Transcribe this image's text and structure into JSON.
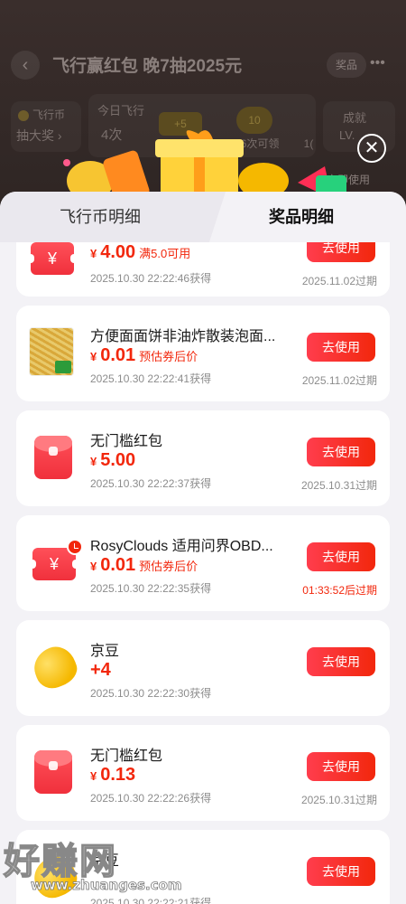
{
  "background": {
    "back_glyph": "‹",
    "title": "飞行赢红包 晚7抽2025元",
    "prize_btn": "奖品",
    "more_glyph": "•••",
    "coin_box_line1": "飞行币",
    "coin_box_line2": "抽大奖 ›",
    "today_label": "今日飞行",
    "today_count": "4次",
    "pill_a": "+5",
    "pill_b": "10",
    "pill_c": "6次可领",
    "pill_d": "1(",
    "achievement_line1": "成就",
    "achievement_line2": "LV.",
    "use_now": "立即使用"
  },
  "close_glyph": "✕",
  "tabs": {
    "coin_detail": "飞行币明细",
    "prize_detail": "奖品明细"
  },
  "items": [
    {
      "icon": "coupon-icon",
      "title": "",
      "currency": "¥",
      "amount": "4.00",
      "note": "满5.0可用",
      "time": "2025.10.30 22:22:46获得",
      "button": "去使用",
      "expiry": "2025.11.02过期"
    },
    {
      "icon": "noodle-product-image",
      "title": "方便面面饼非油炸散装泡面...",
      "currency": "¥",
      "amount": "0.01",
      "note": "预估券后价",
      "time": "2025.10.30 22:22:41获得",
      "button": "去使用",
      "expiry": "2025.11.02过期"
    },
    {
      "icon": "red-envelope-icon",
      "title": "无门槛红包",
      "currency": "¥",
      "amount": "5.00",
      "note": "",
      "time": "2025.10.30 22:22:37获得",
      "button": "去使用",
      "expiry": "2025.10.31过期"
    },
    {
      "icon": "coupon-clock-icon",
      "title": "RosyClouds 适用问界OBD...",
      "currency": "¥",
      "amount": "0.01",
      "note": "预估券后价",
      "time": "2025.10.30 22:22:35获得",
      "button": "去使用",
      "expiry": "01:33:52后过期"
    },
    {
      "icon": "jingdou-bean-icon",
      "title": "京豆",
      "currency": "",
      "amount": "+4",
      "note": "",
      "time": "2025.10.30 22:22:30获得",
      "button": "去使用",
      "expiry": ""
    },
    {
      "icon": "red-envelope-icon",
      "title": "无门槛红包",
      "currency": "¥",
      "amount": "0.13",
      "note": "",
      "time": "2025.10.30 22:22:26获得",
      "button": "去使用",
      "expiry": "2025.10.31过期"
    },
    {
      "icon": "jingdou-bean-icon",
      "title": "京豆",
      "currency": "",
      "amount": "",
      "note": "",
      "time": "2025.10.30 22:22:21获得",
      "button": "去使用",
      "expiry": ""
    }
  ],
  "watermark": {
    "main": "好赚网",
    "url": "www.zhuanges.com"
  },
  "colors": {
    "accent_red": "#f2270c",
    "sheet_bg": "#f3f2f6",
    "card_bg": "#ffffff"
  }
}
